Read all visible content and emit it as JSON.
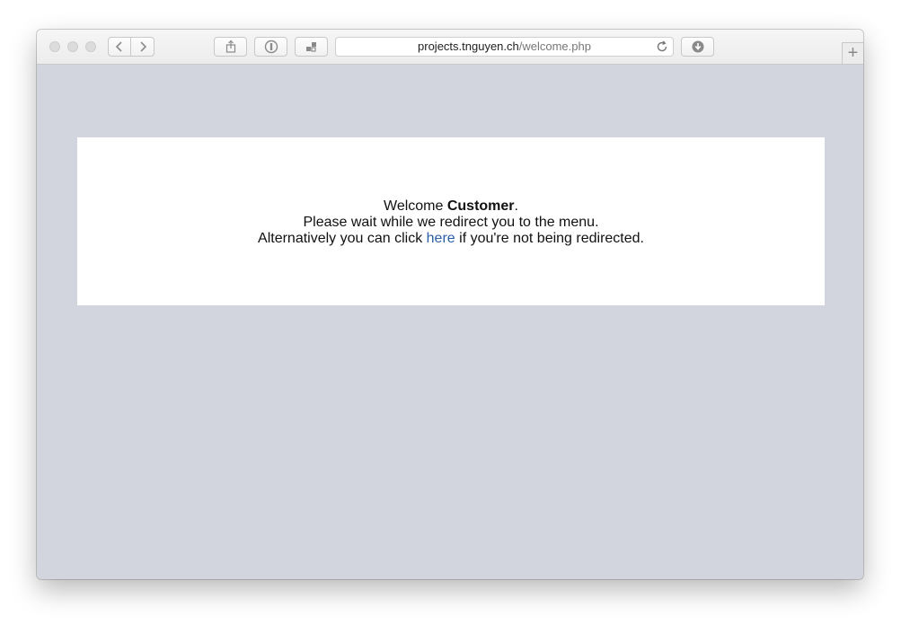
{
  "browser": {
    "url_host": "projects.tnguyen.ch",
    "url_path": "/welcome.php",
    "new_tab_label": "+",
    "icons": {
      "back": "chevron-left-icon",
      "forward": "chevron-right-icon",
      "share": "share-icon",
      "password": "password-icon",
      "extension": "extension-icon",
      "reload": "reload-icon",
      "downloads": "download-icon"
    }
  },
  "page": {
    "welcome_prefix": "Welcome ",
    "welcome_name": "Customer",
    "welcome_suffix": ".",
    "line2": "Please wait while we redirect you to the menu.",
    "line3_prefix": "Alternatively you can click ",
    "line3_link": "here",
    "line3_suffix": " if you're not being redirected."
  },
  "colors": {
    "page_background": "#d2d5dd",
    "card_background": "#ffffff",
    "link": "#2a5ea8"
  }
}
